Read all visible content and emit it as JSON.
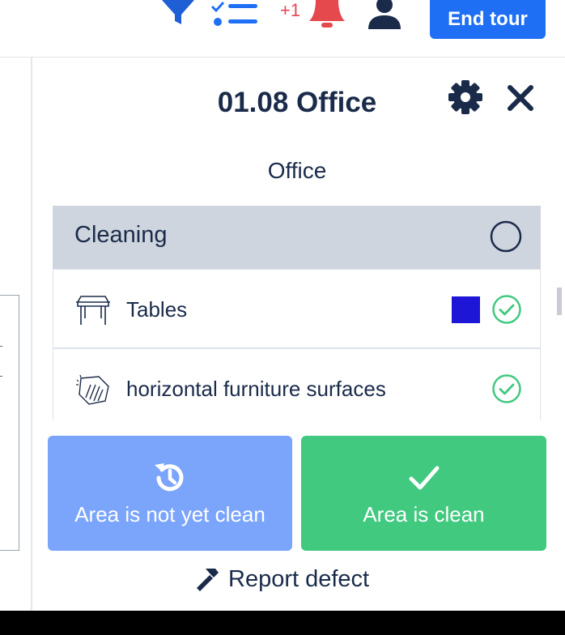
{
  "topbar": {
    "notification_count": "+1",
    "end_tour_label": "End tour",
    "icons": [
      "filter-icon",
      "checklist-icon",
      "bell-icon",
      "user-icon"
    ]
  },
  "panel": {
    "title": "01.08 Office",
    "subtitle": "Office",
    "icons": [
      "gear-icon",
      "close-icon"
    ]
  },
  "section": {
    "label": "Cleaning",
    "status_icon": "circle-icon",
    "items": [
      {
        "label": "Tables",
        "icon": "table-icon",
        "swatch_color": "#1d16d6",
        "status_icon": "check-circle-icon"
      },
      {
        "label": "horizontal furniture surfaces",
        "icon": "wiping-hand-icon",
        "status_icon": "check-circle-icon"
      }
    ]
  },
  "actions": {
    "not_clean_label": "Area is not yet clean",
    "clean_label": "Area is clean",
    "report_defect_label": "Report defect"
  },
  "colors": {
    "primary": "#1f6ff5",
    "not_clean": "#7ba4fb",
    "clean": "#41c980",
    "alert": "#e5484d",
    "text": "#1a2b4a",
    "section_bg": "#cfd5df"
  }
}
